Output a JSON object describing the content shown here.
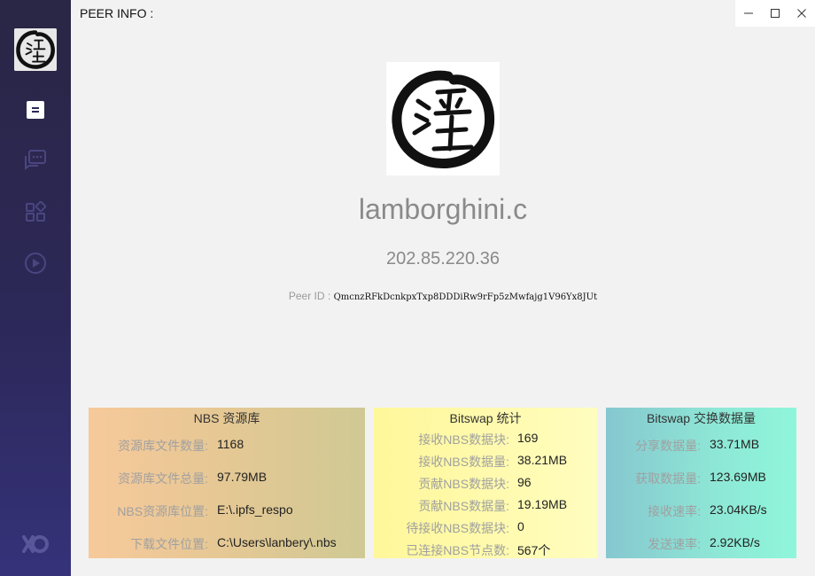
{
  "window": {
    "title": "PEER INFO :",
    "controls": [
      "minimize-icon",
      "maximize-icon",
      "close-icon"
    ]
  },
  "sidebar": {
    "items": [
      {
        "name": "info",
        "icon": "document-icon",
        "active": true
      },
      {
        "name": "chat",
        "icon": "chat-icon",
        "active": false
      },
      {
        "name": "apps",
        "icon": "apps-grid-icon",
        "active": false
      },
      {
        "name": "media",
        "icon": "play-icon",
        "active": false
      }
    ],
    "bottom_icon": "brand-logo-icon"
  },
  "peer": {
    "name": "lamborghini.c",
    "ip": "202.85.220.36",
    "id_label": "Peer ID :",
    "id_value": "QmcnzRFkDcnkpxTxp8DDDiRw9rFp5zMwfajg1V96Yx8JUt"
  },
  "panels": {
    "nbs_repo": {
      "title": "NBS 资源库",
      "rows": [
        {
          "label": "资源库文件数量:",
          "value": "1168"
        },
        {
          "label": "资源库文件总量:",
          "value": "97.79MB"
        },
        {
          "label": "NBS资源库位置:",
          "value": "E:\\.ipfs_respo"
        },
        {
          "label": "下载文件位置:",
          "value": "C:\\Users\\lanbery\\.nbs"
        }
      ]
    },
    "bitswap_stats": {
      "title": "Bitswap 统计",
      "rows": [
        {
          "label": "接收NBS数据块:",
          "value": "169"
        },
        {
          "label": "接收NBS数据量:",
          "value": "38.21MB"
        },
        {
          "label": "贡献NBS数据块:",
          "value": "96"
        },
        {
          "label": "贡献NBS数据量:",
          "value": "19.19MB"
        },
        {
          "label": "待接收NBS数据块:",
          "value": "0"
        },
        {
          "label": "已连接NBS节点数:",
          "value": "567个"
        }
      ]
    },
    "bitswap_exchange": {
      "title": "Bitswap 交换数据量",
      "rows": [
        {
          "label": "分享数据量:",
          "value": "33.71MB"
        },
        {
          "label": "获取数据量:",
          "value": "123.69MB"
        },
        {
          "label": "接收速率:",
          "value": "23.04KB/s"
        },
        {
          "label": "发送速率:",
          "value": "2.92KB/s"
        }
      ]
    }
  },
  "colors": {
    "sidebar_top": "#2a2645",
    "sidebar_bottom": "#35327a",
    "panel1_start": "#f7c99b",
    "panel1_end": "#cfc994",
    "panel2_start": "#fff79a",
    "panel2_end": "#fffdbf",
    "panel3_start": "#86c7cf",
    "panel3_end": "#8ff6da"
  }
}
